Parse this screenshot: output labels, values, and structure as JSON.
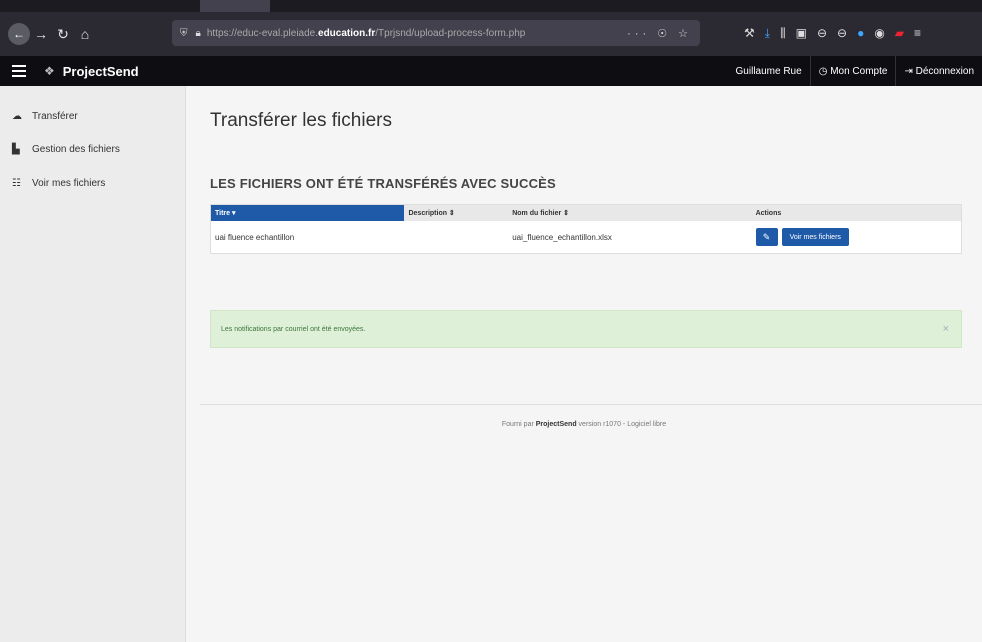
{
  "browser": {
    "url_prefix": "https://educ-eval.pleiade.",
    "url_domain": "education.fr",
    "url_path": "/Tprjsnd/upload-process-form.php",
    "url_actions": "··· ☉ ☆"
  },
  "header": {
    "brand": "ProjectSend",
    "user": "Guillaume Rue",
    "account": "Mon Compte",
    "logout": "Déconnexion"
  },
  "sidebar": {
    "items": [
      {
        "label": "Transférer",
        "icon": "upload-icon"
      },
      {
        "label": "Gestion des fichiers",
        "icon": "file-icon"
      },
      {
        "label": "Voir mes fichiers",
        "icon": "list-icon"
      }
    ]
  },
  "main": {
    "title": "Transférer les fichiers",
    "section_title": "LES FICHIERS ONT ÉTÉ TRANSFÉRÉS AVEC SUCCÈS",
    "table": {
      "headers": [
        "Titre ▾",
        "Description ⇕",
        "Nom du fichier ⇕",
        "Actions"
      ],
      "rows": [
        {
          "title": "uai fluence echantillon",
          "description": "",
          "filename": "uai_fluence_echantillon.xlsx",
          "action_label": "Voir mes fichiers"
        }
      ]
    },
    "alert": "Les notifications par courriel ont été envoyées.",
    "alert_close": "×",
    "footer_prefix": "Fourni par ",
    "footer_brand": "ProjectSend",
    "footer_suffix": " version r1070 - Logiciel libre"
  },
  "colors": {
    "accent": "#1f5aa8",
    "header_bg": "#0e0e12",
    "alert_bg": "#dff0d8"
  }
}
